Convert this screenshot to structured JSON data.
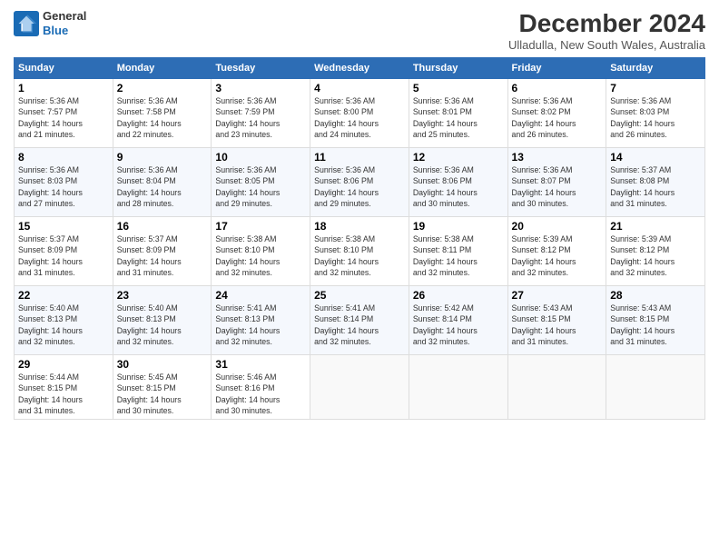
{
  "logo": {
    "line1": "General",
    "line2": "Blue"
  },
  "title": "December 2024",
  "subtitle": "Ulladulla, New South Wales, Australia",
  "days_of_week": [
    "Sunday",
    "Monday",
    "Tuesday",
    "Wednesday",
    "Thursday",
    "Friday",
    "Saturday"
  ],
  "weeks": [
    [
      {
        "day": 1,
        "info": "Sunrise: 5:36 AM\nSunset: 7:57 PM\nDaylight: 14 hours\nand 21 minutes."
      },
      {
        "day": 2,
        "info": "Sunrise: 5:36 AM\nSunset: 7:58 PM\nDaylight: 14 hours\nand 22 minutes."
      },
      {
        "day": 3,
        "info": "Sunrise: 5:36 AM\nSunset: 7:59 PM\nDaylight: 14 hours\nand 23 minutes."
      },
      {
        "day": 4,
        "info": "Sunrise: 5:36 AM\nSunset: 8:00 PM\nDaylight: 14 hours\nand 24 minutes."
      },
      {
        "day": 5,
        "info": "Sunrise: 5:36 AM\nSunset: 8:01 PM\nDaylight: 14 hours\nand 25 minutes."
      },
      {
        "day": 6,
        "info": "Sunrise: 5:36 AM\nSunset: 8:02 PM\nDaylight: 14 hours\nand 26 minutes."
      },
      {
        "day": 7,
        "info": "Sunrise: 5:36 AM\nSunset: 8:03 PM\nDaylight: 14 hours\nand 26 minutes."
      }
    ],
    [
      {
        "day": 8,
        "info": "Sunrise: 5:36 AM\nSunset: 8:03 PM\nDaylight: 14 hours\nand 27 minutes."
      },
      {
        "day": 9,
        "info": "Sunrise: 5:36 AM\nSunset: 8:04 PM\nDaylight: 14 hours\nand 28 minutes."
      },
      {
        "day": 10,
        "info": "Sunrise: 5:36 AM\nSunset: 8:05 PM\nDaylight: 14 hours\nand 29 minutes."
      },
      {
        "day": 11,
        "info": "Sunrise: 5:36 AM\nSunset: 8:06 PM\nDaylight: 14 hours\nand 29 minutes."
      },
      {
        "day": 12,
        "info": "Sunrise: 5:36 AM\nSunset: 8:06 PM\nDaylight: 14 hours\nand 30 minutes."
      },
      {
        "day": 13,
        "info": "Sunrise: 5:36 AM\nSunset: 8:07 PM\nDaylight: 14 hours\nand 30 minutes."
      },
      {
        "day": 14,
        "info": "Sunrise: 5:37 AM\nSunset: 8:08 PM\nDaylight: 14 hours\nand 31 minutes."
      }
    ],
    [
      {
        "day": 15,
        "info": "Sunrise: 5:37 AM\nSunset: 8:09 PM\nDaylight: 14 hours\nand 31 minutes."
      },
      {
        "day": 16,
        "info": "Sunrise: 5:37 AM\nSunset: 8:09 PM\nDaylight: 14 hours\nand 31 minutes."
      },
      {
        "day": 17,
        "info": "Sunrise: 5:38 AM\nSunset: 8:10 PM\nDaylight: 14 hours\nand 32 minutes."
      },
      {
        "day": 18,
        "info": "Sunrise: 5:38 AM\nSunset: 8:10 PM\nDaylight: 14 hours\nand 32 minutes."
      },
      {
        "day": 19,
        "info": "Sunrise: 5:38 AM\nSunset: 8:11 PM\nDaylight: 14 hours\nand 32 minutes."
      },
      {
        "day": 20,
        "info": "Sunrise: 5:39 AM\nSunset: 8:12 PM\nDaylight: 14 hours\nand 32 minutes."
      },
      {
        "day": 21,
        "info": "Sunrise: 5:39 AM\nSunset: 8:12 PM\nDaylight: 14 hours\nand 32 minutes."
      }
    ],
    [
      {
        "day": 22,
        "info": "Sunrise: 5:40 AM\nSunset: 8:13 PM\nDaylight: 14 hours\nand 32 minutes."
      },
      {
        "day": 23,
        "info": "Sunrise: 5:40 AM\nSunset: 8:13 PM\nDaylight: 14 hours\nand 32 minutes."
      },
      {
        "day": 24,
        "info": "Sunrise: 5:41 AM\nSunset: 8:13 PM\nDaylight: 14 hours\nand 32 minutes."
      },
      {
        "day": 25,
        "info": "Sunrise: 5:41 AM\nSunset: 8:14 PM\nDaylight: 14 hours\nand 32 minutes."
      },
      {
        "day": 26,
        "info": "Sunrise: 5:42 AM\nSunset: 8:14 PM\nDaylight: 14 hours\nand 32 minutes."
      },
      {
        "day": 27,
        "info": "Sunrise: 5:43 AM\nSunset: 8:15 PM\nDaylight: 14 hours\nand 31 minutes."
      },
      {
        "day": 28,
        "info": "Sunrise: 5:43 AM\nSunset: 8:15 PM\nDaylight: 14 hours\nand 31 minutes."
      }
    ],
    [
      {
        "day": 29,
        "info": "Sunrise: 5:44 AM\nSunset: 8:15 PM\nDaylight: 14 hours\nand 31 minutes."
      },
      {
        "day": 30,
        "info": "Sunrise: 5:45 AM\nSunset: 8:15 PM\nDaylight: 14 hours\nand 30 minutes."
      },
      {
        "day": 31,
        "info": "Sunrise: 5:46 AM\nSunset: 8:16 PM\nDaylight: 14 hours\nand 30 minutes."
      },
      null,
      null,
      null,
      null
    ]
  ]
}
